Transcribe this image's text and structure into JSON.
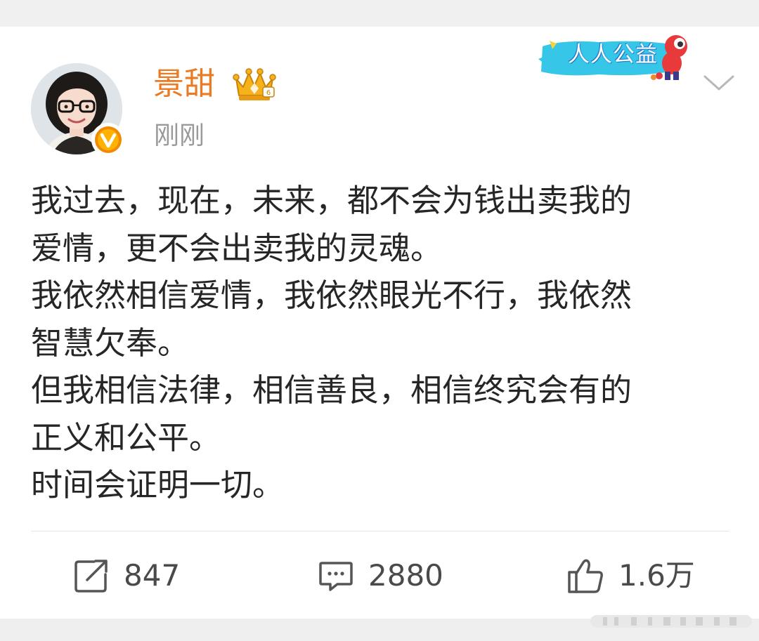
{
  "post": {
    "author": {
      "name": "景甜",
      "avatar_icon": "profile-photo",
      "verified_icon": "verified-v-icon",
      "vip_icon": "gold-crown-icon"
    },
    "time": "刚刚",
    "charity_badge": "人人公益",
    "body": [
      "我过去，现在，未来，都不会为钱出卖我的",
      "爱情，更不会出卖我的灵魂。",
      "我依然相信爱情，我依然眼光不行，我依然",
      "智慧欠奉。",
      "但我相信法律，相信善良，相信终究会有的",
      "正义和公平。",
      "时间会证明一切。"
    ],
    "actions": {
      "repost_count": "847",
      "comment_count": "2880",
      "like_count": "1.6万"
    }
  },
  "colors": {
    "username": "#ec7a22",
    "time": "#9a9a9a",
    "body_text": "#262626",
    "verified": "#f08a00",
    "action_icon": "#555555"
  }
}
